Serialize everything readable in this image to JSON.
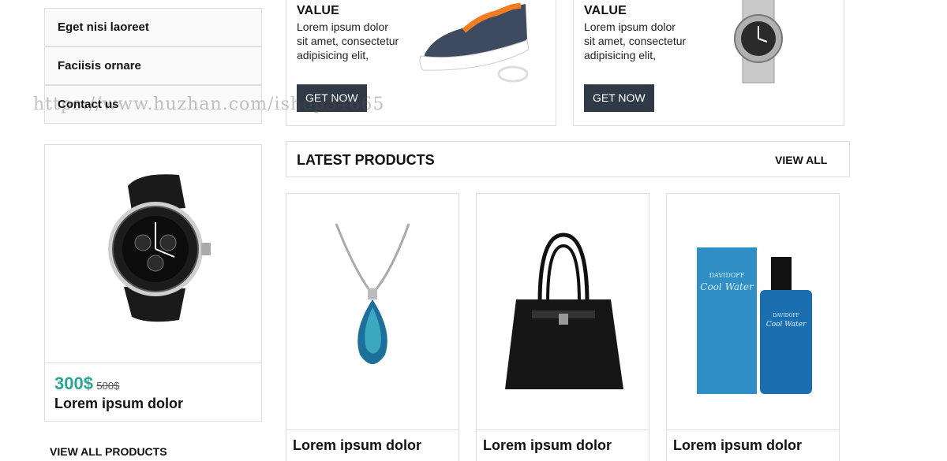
{
  "sidebar": {
    "items": [
      {
        "label": "Eget nisi laoreet"
      },
      {
        "label": "Faciisis ornare"
      },
      {
        "label": "Contact us"
      }
    ]
  },
  "promos": [
    {
      "title": "VALUE",
      "text": "Lorem ipsum dolor sit amet, consectetur adipisicing elit,",
      "button": "GET NOW"
    },
    {
      "title": "VALUE",
      "text": "Lorem ipsum dolor sit amet, consectetur adipisicing elit,",
      "button": "GET NOW"
    }
  ],
  "featured": {
    "price": "300$",
    "old_price": "500$",
    "name": "Lorem ipsum dolor",
    "view_all": "VIEW ALL PRODUCTS"
  },
  "latest": {
    "heading": "LATEST PRODUCTS",
    "view_all": "VIEW ALL",
    "products": [
      {
        "name": "Lorem ipsum dolor"
      },
      {
        "name": "Lorem ipsum dolor"
      },
      {
        "name": "Lorem ipsum dolor"
      }
    ]
  },
  "watermark": "https://www.huzhan.com/ishop34665",
  "colors": {
    "accent": "#2aa596",
    "button": "#303a46",
    "border": "#dedede"
  }
}
